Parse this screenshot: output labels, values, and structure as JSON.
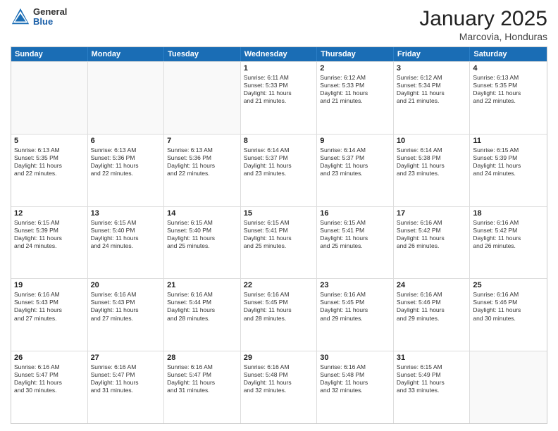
{
  "header": {
    "logo_general": "General",
    "logo_blue": "Blue",
    "month_title": "January 2025",
    "location": "Marcovia, Honduras"
  },
  "weekdays": [
    "Sunday",
    "Monday",
    "Tuesday",
    "Wednesday",
    "Thursday",
    "Friday",
    "Saturday"
  ],
  "rows": [
    [
      {
        "day": "",
        "empty": true,
        "lines": []
      },
      {
        "day": "",
        "empty": true,
        "lines": []
      },
      {
        "day": "",
        "empty": true,
        "lines": []
      },
      {
        "day": "1",
        "lines": [
          "Sunrise: 6:11 AM",
          "Sunset: 5:33 PM",
          "Daylight: 11 hours",
          "and 21 minutes."
        ]
      },
      {
        "day": "2",
        "lines": [
          "Sunrise: 6:12 AM",
          "Sunset: 5:33 PM",
          "Daylight: 11 hours",
          "and 21 minutes."
        ]
      },
      {
        "day": "3",
        "lines": [
          "Sunrise: 6:12 AM",
          "Sunset: 5:34 PM",
          "Daylight: 11 hours",
          "and 21 minutes."
        ]
      },
      {
        "day": "4",
        "lines": [
          "Sunrise: 6:13 AM",
          "Sunset: 5:35 PM",
          "Daylight: 11 hours",
          "and 22 minutes."
        ]
      }
    ],
    [
      {
        "day": "5",
        "lines": [
          "Sunrise: 6:13 AM",
          "Sunset: 5:35 PM",
          "Daylight: 11 hours",
          "and 22 minutes."
        ]
      },
      {
        "day": "6",
        "lines": [
          "Sunrise: 6:13 AM",
          "Sunset: 5:36 PM",
          "Daylight: 11 hours",
          "and 22 minutes."
        ]
      },
      {
        "day": "7",
        "lines": [
          "Sunrise: 6:13 AM",
          "Sunset: 5:36 PM",
          "Daylight: 11 hours",
          "and 22 minutes."
        ]
      },
      {
        "day": "8",
        "lines": [
          "Sunrise: 6:14 AM",
          "Sunset: 5:37 PM",
          "Daylight: 11 hours",
          "and 23 minutes."
        ]
      },
      {
        "day": "9",
        "lines": [
          "Sunrise: 6:14 AM",
          "Sunset: 5:37 PM",
          "Daylight: 11 hours",
          "and 23 minutes."
        ]
      },
      {
        "day": "10",
        "lines": [
          "Sunrise: 6:14 AM",
          "Sunset: 5:38 PM",
          "Daylight: 11 hours",
          "and 23 minutes."
        ]
      },
      {
        "day": "11",
        "lines": [
          "Sunrise: 6:15 AM",
          "Sunset: 5:39 PM",
          "Daylight: 11 hours",
          "and 24 minutes."
        ]
      }
    ],
    [
      {
        "day": "12",
        "lines": [
          "Sunrise: 6:15 AM",
          "Sunset: 5:39 PM",
          "Daylight: 11 hours",
          "and 24 minutes."
        ]
      },
      {
        "day": "13",
        "lines": [
          "Sunrise: 6:15 AM",
          "Sunset: 5:40 PM",
          "Daylight: 11 hours",
          "and 24 minutes."
        ]
      },
      {
        "day": "14",
        "lines": [
          "Sunrise: 6:15 AM",
          "Sunset: 5:40 PM",
          "Daylight: 11 hours",
          "and 25 minutes."
        ]
      },
      {
        "day": "15",
        "lines": [
          "Sunrise: 6:15 AM",
          "Sunset: 5:41 PM",
          "Daylight: 11 hours",
          "and 25 minutes."
        ]
      },
      {
        "day": "16",
        "lines": [
          "Sunrise: 6:15 AM",
          "Sunset: 5:41 PM",
          "Daylight: 11 hours",
          "and 25 minutes."
        ]
      },
      {
        "day": "17",
        "lines": [
          "Sunrise: 6:16 AM",
          "Sunset: 5:42 PM",
          "Daylight: 11 hours",
          "and 26 minutes."
        ]
      },
      {
        "day": "18",
        "lines": [
          "Sunrise: 6:16 AM",
          "Sunset: 5:42 PM",
          "Daylight: 11 hours",
          "and 26 minutes."
        ]
      }
    ],
    [
      {
        "day": "19",
        "lines": [
          "Sunrise: 6:16 AM",
          "Sunset: 5:43 PM",
          "Daylight: 11 hours",
          "and 27 minutes."
        ]
      },
      {
        "day": "20",
        "lines": [
          "Sunrise: 6:16 AM",
          "Sunset: 5:43 PM",
          "Daylight: 11 hours",
          "and 27 minutes."
        ]
      },
      {
        "day": "21",
        "lines": [
          "Sunrise: 6:16 AM",
          "Sunset: 5:44 PM",
          "Daylight: 11 hours",
          "and 28 minutes."
        ]
      },
      {
        "day": "22",
        "lines": [
          "Sunrise: 6:16 AM",
          "Sunset: 5:45 PM",
          "Daylight: 11 hours",
          "and 28 minutes."
        ]
      },
      {
        "day": "23",
        "lines": [
          "Sunrise: 6:16 AM",
          "Sunset: 5:45 PM",
          "Daylight: 11 hours",
          "and 29 minutes."
        ]
      },
      {
        "day": "24",
        "lines": [
          "Sunrise: 6:16 AM",
          "Sunset: 5:46 PM",
          "Daylight: 11 hours",
          "and 29 minutes."
        ]
      },
      {
        "day": "25",
        "lines": [
          "Sunrise: 6:16 AM",
          "Sunset: 5:46 PM",
          "Daylight: 11 hours",
          "and 30 minutes."
        ]
      }
    ],
    [
      {
        "day": "26",
        "lines": [
          "Sunrise: 6:16 AM",
          "Sunset: 5:47 PM",
          "Daylight: 11 hours",
          "and 30 minutes."
        ]
      },
      {
        "day": "27",
        "lines": [
          "Sunrise: 6:16 AM",
          "Sunset: 5:47 PM",
          "Daylight: 11 hours",
          "and 31 minutes."
        ]
      },
      {
        "day": "28",
        "lines": [
          "Sunrise: 6:16 AM",
          "Sunset: 5:47 PM",
          "Daylight: 11 hours",
          "and 31 minutes."
        ]
      },
      {
        "day": "29",
        "lines": [
          "Sunrise: 6:16 AM",
          "Sunset: 5:48 PM",
          "Daylight: 11 hours",
          "and 32 minutes."
        ]
      },
      {
        "day": "30",
        "lines": [
          "Sunrise: 6:16 AM",
          "Sunset: 5:48 PM",
          "Daylight: 11 hours",
          "and 32 minutes."
        ]
      },
      {
        "day": "31",
        "lines": [
          "Sunrise: 6:15 AM",
          "Sunset: 5:49 PM",
          "Daylight: 11 hours",
          "and 33 minutes."
        ]
      },
      {
        "day": "",
        "empty": true,
        "lines": []
      }
    ]
  ]
}
